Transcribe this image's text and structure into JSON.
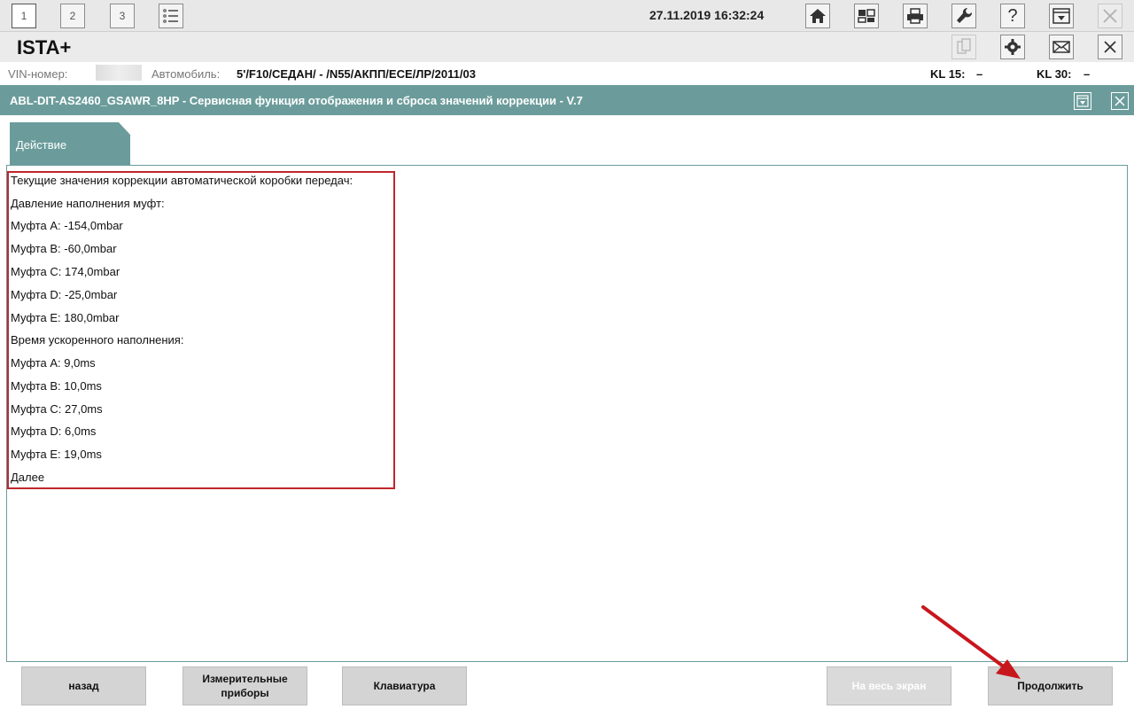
{
  "toolbar": {
    "tabs": [
      "1",
      "2",
      "3"
    ],
    "datetime": "27.11.2019 16:32:24",
    "icons": [
      "list-icon",
      "home-icon",
      "vehicle-info-icon",
      "print-icon",
      "wrench-icon",
      "help-icon",
      "minimize-icon",
      "close-icon"
    ],
    "help_label": "?"
  },
  "app": {
    "title": "ISTA+",
    "icons": [
      "document-icon",
      "gear-icon",
      "mail-icon",
      "close-icon"
    ]
  },
  "vehicle": {
    "vin_label": "VIN-номер:",
    "car_label": "Автомобиль:",
    "car_value": "5'/F10/СЕДАН/ - /N55/АКПП/ECE/ЛР/2011/03",
    "kl15_label": "KL 15:",
    "kl15_value": "–",
    "kl30_label": "KL 30:",
    "kl30_value": "–"
  },
  "function": {
    "title": "ABL-DIT-AS2460_GSAWR_8HP - Сервисная функция отображения и сброса значений коррекции - V.7"
  },
  "tab": {
    "label": "Действие"
  },
  "results": {
    "lines": [
      "Текущие значения коррекции автоматической коробки передач:",
      "Давление наполнения муфт:",
      "Муфта A: -154,0mbar",
      "Муфта B: -60,0mbar",
      "Муфта C: 174,0mbar",
      "Муфта D: -25,0mbar",
      "Муфта E: 180,0mbar",
      "Время ускоренного наполнения:",
      "Муфта A: 9,0ms",
      "Муфта B: 10,0ms",
      "Муфта C: 27,0ms",
      "Муфта D: 6,0ms",
      "Муфта E: 19,0ms",
      "Далее"
    ]
  },
  "buttons": {
    "back": "назад",
    "measuring_1": "Измерительные",
    "measuring_2": "приборы",
    "keyboard": "Клавиатура",
    "fullscreen": "На весь экран",
    "continue": "Продолжить"
  },
  "colors": {
    "accent": "#6b9c9b",
    "highlight_border": "#c0262d",
    "annotation_arrow": "#c8161d"
  }
}
